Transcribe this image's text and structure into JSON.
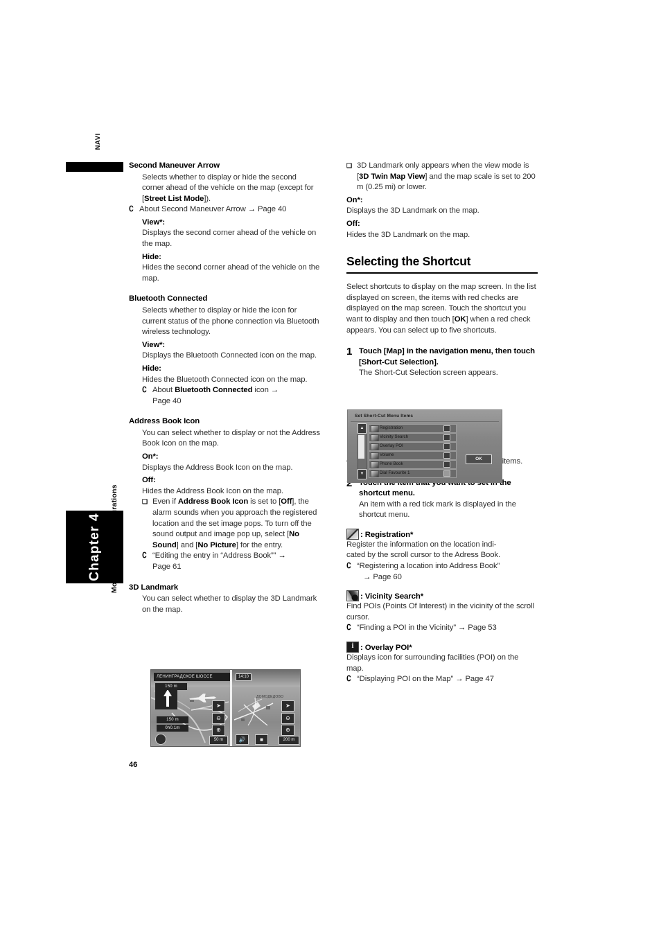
{
  "page": {
    "folio": "46",
    "navi_tab_label": "NAVI",
    "chapter_label": "Chapter 4",
    "chapter_subtitle": "Modifying Map Configurations"
  },
  "left_column": {
    "sections": [
      {
        "heading": "Second Maneuver Arrow",
        "body": "Selects whether to display or hide the second corner ahead of the vehicle on the map (except for [Street List Mode]).",
        "reference": "About Second Maneuver Arrow → Page 40",
        "options": [
          {
            "label": "View*:",
            "text": "Displays the second corner ahead of the vehicle on the map."
          },
          {
            "label": "Hide:",
            "text": "Hides the second corner ahead of the vehicle on the map."
          }
        ]
      },
      {
        "heading": "Bluetooth Connected",
        "body": "Selects whether to display or hide the icon for current status of the phone connection via Bluetooth wireless technology.",
        "options": [
          {
            "label": "View*:",
            "text": "Displays the Bluetooth Connected icon on the map."
          },
          {
            "label": "Hide:",
            "text": "Hides the Bluetooth Connected icon on the map."
          }
        ],
        "reference": "About Bluetooth Connected icon → Page 40"
      },
      {
        "heading": "Address Book Icon",
        "body": "You can select whether to display or not the Address Book Icon on the map.",
        "options": [
          {
            "label": "On*:",
            "text": "Displays the Address Book Icon on the map."
          },
          {
            "label": "Off:",
            "text": "Hides the Address Book Icon on the map."
          }
        ],
        "note": "Even if Address Book Icon is set to [Off], the alarm sounds when you approach the registered location and the set image pops. To turn off the sound output and image pop up, select [No Sound] and [No Picture] for the entry.",
        "reference": "“Editing the entry in “Address Book”” → Page 61"
      },
      {
        "heading": "3D Landmark",
        "body": "You can select whether to display the 3D Landmark on the map."
      }
    ]
  },
  "right_column": {
    "landmark_note": "3D Landmark only appears when the view mode is [3D Twin Map View] and the map scale is set to 200 m (0.25 mi) or lower.",
    "landmark_options": [
      {
        "label": "On*:",
        "text": "Displays the 3D Landmark on the map."
      },
      {
        "label": "Off:",
        "text": "Hides the 3D Landmark on the map."
      }
    ],
    "section_heading": "Selecting the Shortcut",
    "intro": "Select shortcuts to display on the map screen. In the list displayed on screen, the items with red checks are displayed on the map screen. Touch the shortcut you want to display and then touch [OK] when a red check appears. You can select up to five shortcuts.",
    "steps": [
      {
        "number": "1",
        "title": "Touch [Map] in the navigation menu, then touch [Short-Cut Selection].",
        "body": "The Short-Cut Selection screen appears.",
        "after_figure": "On this screen, you can operate the following items."
      },
      {
        "number": "2",
        "title": "Touch the item that you want to set in the shortcut menu.",
        "body": "An item with a red tick mark is displayed in the shortcut menu."
      }
    ],
    "shortcut_items": [
      {
        "icon": "registration-icon",
        "label": ": Registration*",
        "body": "Register the information on the location indicated by the scroll cursor to the Adress Book.",
        "reference": "“Registering a location into Address Book” → Page 60"
      },
      {
        "icon": "vicinity-search-icon",
        "label": ": Vicinity Search*",
        "body": "Find POIs (Points Of Interest) in the vicinity of the scroll cursor.",
        "reference": "“Finding a POI in the Vicinity” → Page 53"
      },
      {
        "icon": "overlay-poi-icon",
        "label": ": Overlay POI*",
        "body": "Displays icon for surrounding facilities (POI) on the map.",
        "reference": "“Displaying POI on the Map” → Page 47"
      }
    ]
  },
  "figure_twin_map": {
    "street_name": "ЛЕНИНГРАДСКОЕ ШОССЕ",
    "maneuver_distance": "150 m",
    "remaining_distance": "150 m",
    "remaining_time": "0h0.1m",
    "clock": "14:10",
    "poi_name": "ДОМОДЕДОВО",
    "left_scale": "50 m",
    "right_scale": "200 m"
  },
  "figure_shortcut_screen": {
    "title": "Set Short-Cut Menu Items",
    "ok_label": "OK",
    "rows": [
      {
        "label": "Registration",
        "checked": true
      },
      {
        "label": "Vicinity Search",
        "checked": true
      },
      {
        "label": "Overlay POI",
        "checked": true
      },
      {
        "label": "Volume",
        "checked": true
      },
      {
        "label": "Phone Book",
        "checked": true
      },
      {
        "label": "Dial Favourite 1",
        "checked": false
      }
    ]
  }
}
